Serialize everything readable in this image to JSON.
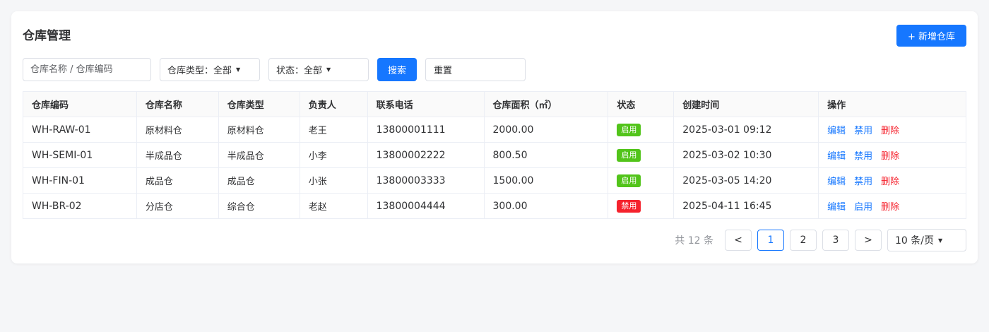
{
  "page": {
    "title": "仓库管理",
    "add_button": "+ 新增仓库"
  },
  "filters": {
    "search_placeholder": "仓库名称 / 仓库编码",
    "type_label": "仓库类型：全部",
    "status_label": "状态：全部",
    "search_button": "搜索",
    "reset_button": "重置"
  },
  "table": {
    "columns": [
      "仓库编码",
      "仓库名称",
      "仓库类型",
      "负责人",
      "联系电话",
      "仓库面积（㎡）",
      "状态",
      "创建时间",
      "操作"
    ],
    "rows": [
      {
        "code": "WH-RAW-01",
        "name": "原材料仓",
        "type": "原材料仓",
        "manager": "老王",
        "phone": "13800001111",
        "area": "2000.00",
        "status": "启用",
        "status_color": "#52c41a",
        "created": "2025-03-01 09:12",
        "actions": [
          "编辑",
          "禁用",
          "删除"
        ]
      },
      {
        "code": "WH-SEMI-01",
        "name": "半成品仓",
        "type": "半成品仓",
        "manager": "小李",
        "phone": "13800002222",
        "area": "800.50",
        "status": "启用",
        "status_color": "#52c41a",
        "created": "2025-03-02 10:30",
        "actions": [
          "编辑",
          "禁用",
          "删除"
        ]
      },
      {
        "code": "WH-FIN-01",
        "name": "成品仓",
        "type": "成品仓",
        "manager": "小张",
        "phone": "13800003333",
        "area": "1500.00",
        "status": "启用",
        "status_color": "#52c41a",
        "created": "2025-03-05 14:20",
        "actions": [
          "编辑",
          "禁用",
          "删除"
        ]
      },
      {
        "code": "WH-BR-02",
        "name": "分店仓",
        "type": "综合仓",
        "manager": "老赵",
        "phone": "13800004444",
        "area": "300.00",
        "status": "禁用",
        "status_color": "#f5222d",
        "created": "2025-04-11 16:45",
        "actions": [
          "编辑",
          "启用",
          "删除"
        ]
      }
    ]
  },
  "pagination": {
    "total": "共 12 条",
    "prev": "<",
    "pages": [
      "1",
      "2",
      "3"
    ],
    "current": "1",
    "next": ">",
    "page_size": "10 条/页"
  },
  "colors": {
    "primary": "#1677ff",
    "danger": "#f5222d",
    "success": "#52c41a"
  }
}
